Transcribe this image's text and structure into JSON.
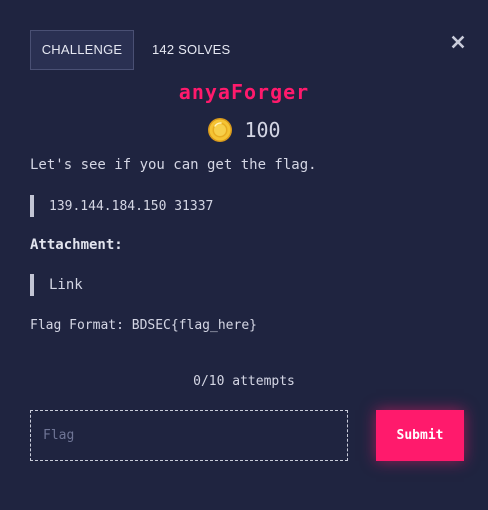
{
  "header": {
    "tab_challenge": "CHALLENGE",
    "tab_solves": "142 SOLVES"
  },
  "challenge": {
    "name": "anyaForger",
    "points": "100",
    "description": "Let's see if you can get the flag.",
    "connection": "139.144.184.150 31337",
    "attachment_heading": "Attachment:",
    "attachment_link": "Link",
    "flag_format": "Flag Format: BDSEC{flag_here}"
  },
  "form": {
    "attempts": "0/10 attempts",
    "flag_placeholder": "Flag",
    "submit_label": "Submit"
  },
  "colors": {
    "background": "#1f2440",
    "accent": "#ff1a6c",
    "tab_background": "#2a3052"
  },
  "icons": {
    "close": "close-icon",
    "coin": "coin-icon"
  }
}
